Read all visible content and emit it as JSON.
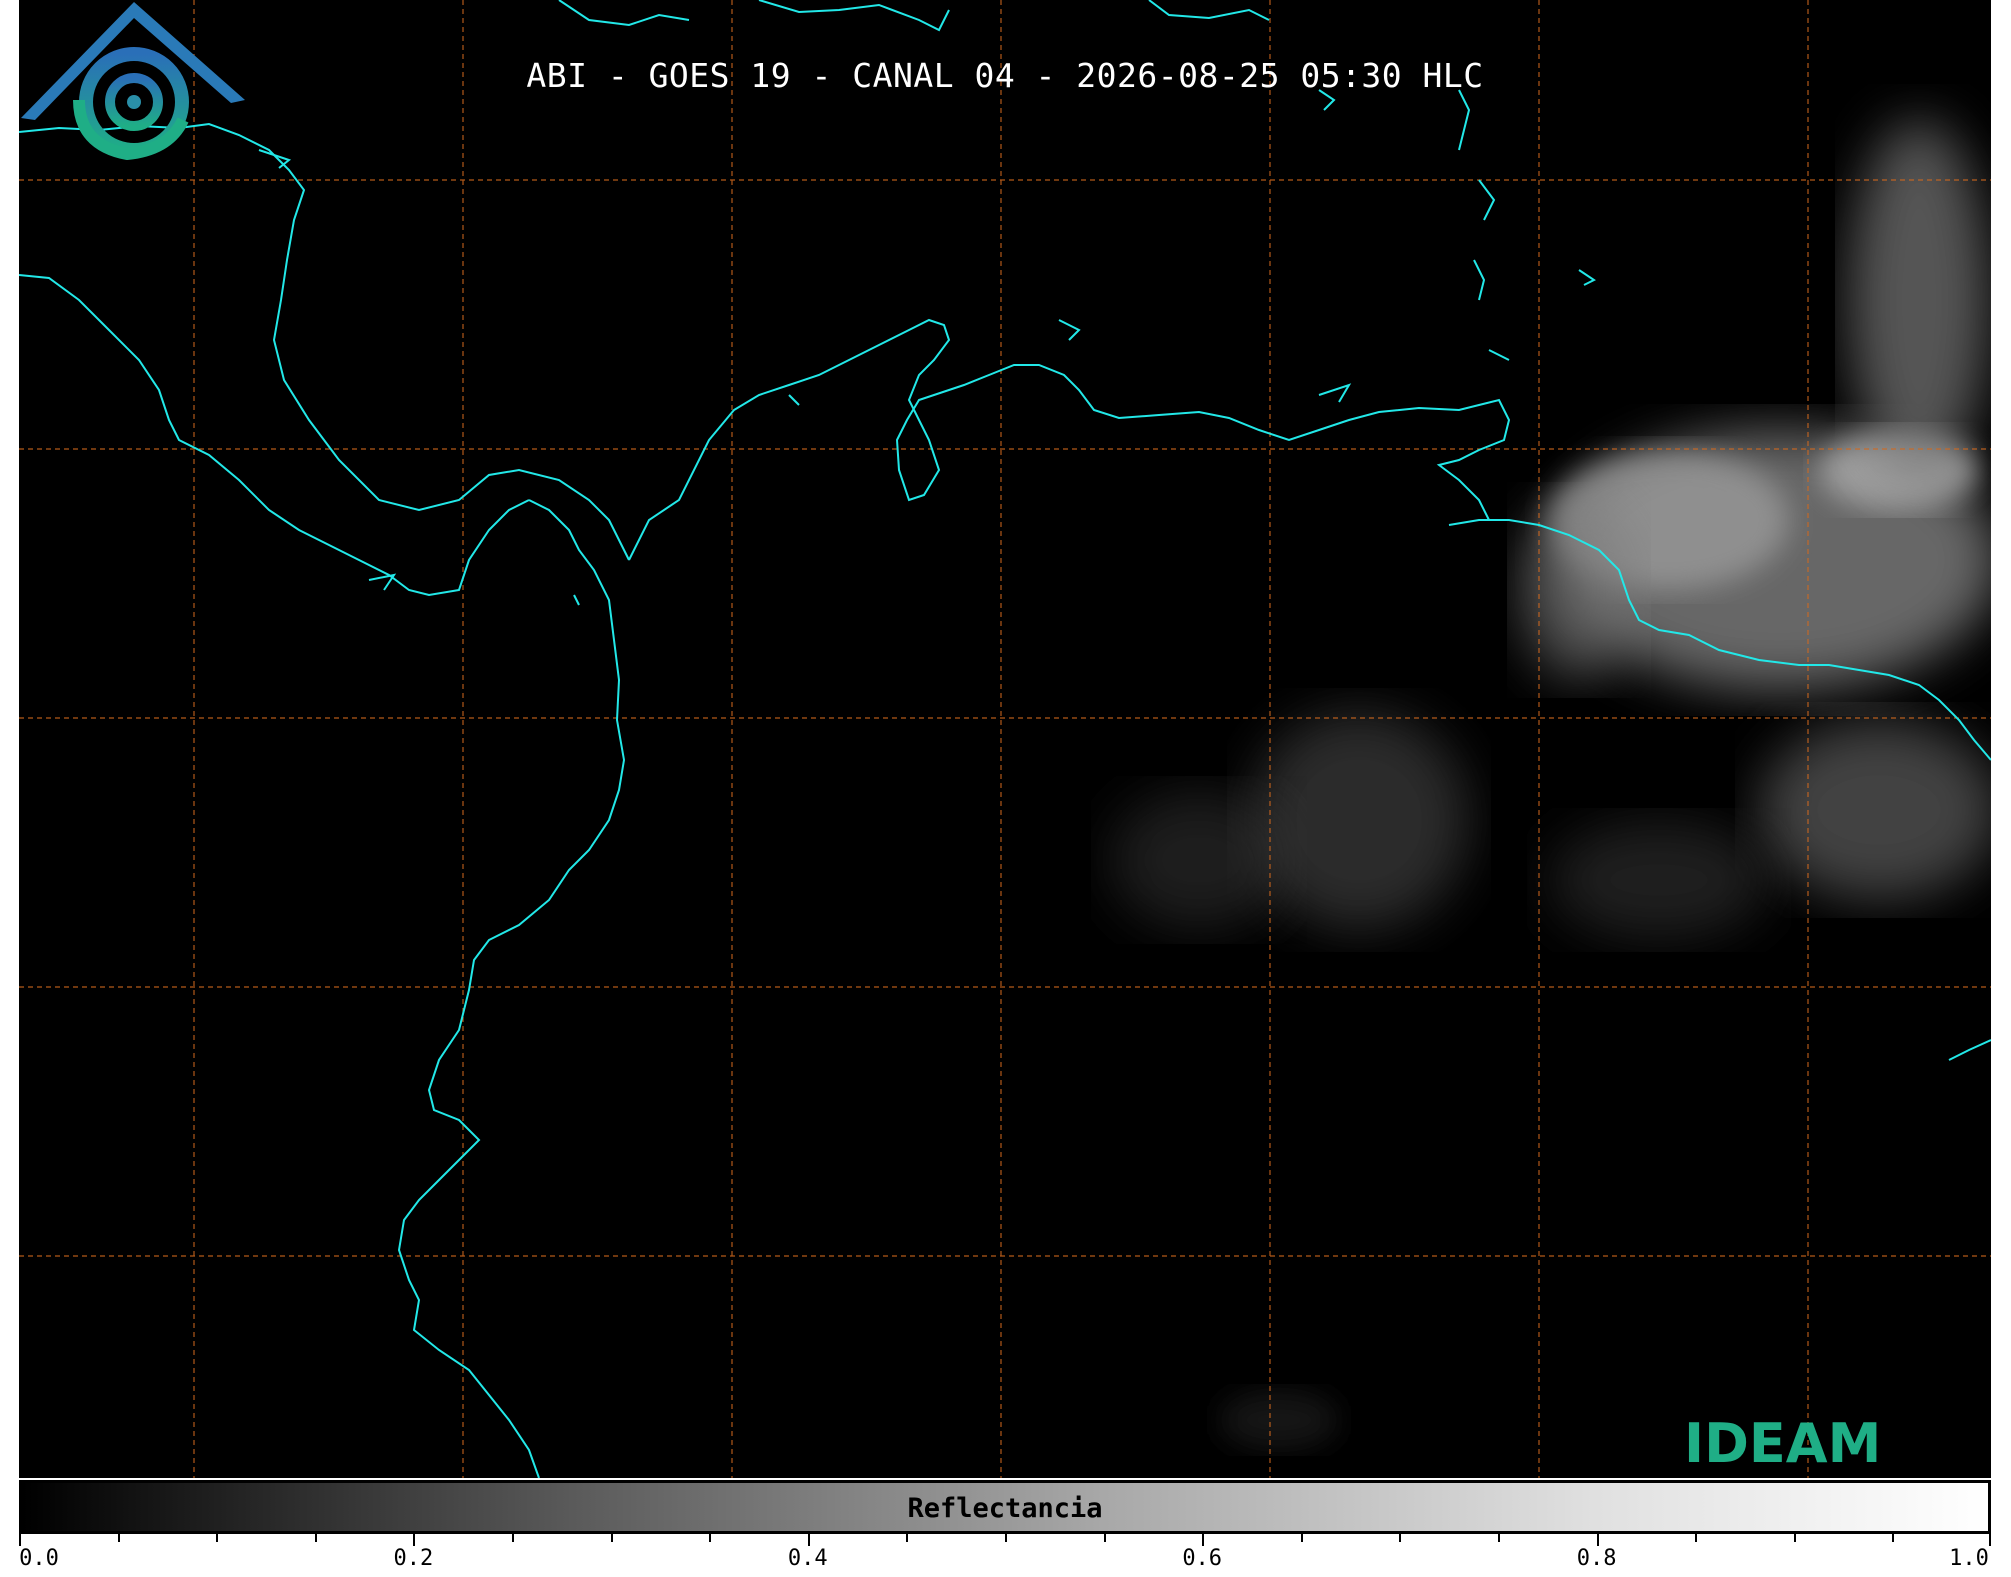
{
  "title": "ABI - GOES 19 - CANAL 04 - 2026-08-25 05:30 HLC",
  "colorbar": {
    "label": "Reflectancia",
    "min": 0.0,
    "max": 1.0,
    "major_ticks": [
      "0.0",
      "0.2",
      "0.4",
      "0.6",
      "0.8",
      "1.0"
    ],
    "minor_tick_step": 0.05
  },
  "logo": {
    "text": "IDEAM",
    "icon": "ideam-logo-icon"
  },
  "colors": {
    "coastline": "#22e8e8",
    "gridlines": "#d2691e",
    "background": "#000000",
    "logo_blue": "#2a7ab8",
    "logo_green": "#1fae86"
  }
}
